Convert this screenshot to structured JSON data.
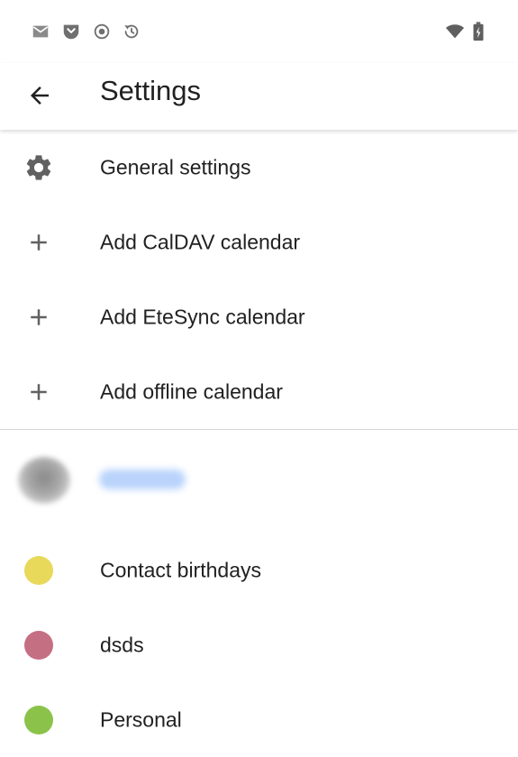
{
  "status_bar": {
    "icons": [
      "mail-icon",
      "pocket-icon",
      "record-icon",
      "sync-icon",
      "wifi-icon",
      "battery-icon"
    ]
  },
  "app_bar": {
    "title": "Settings",
    "back_icon": "arrow-back-icon"
  },
  "menu": [
    {
      "icon": "gear-icon",
      "label": "General settings"
    },
    {
      "icon": "plus-icon",
      "label": "Add CalDAV calendar"
    },
    {
      "icon": "plus-icon",
      "label": "Add EteSync calendar"
    },
    {
      "icon": "plus-icon",
      "label": "Add offline calendar"
    }
  ],
  "account": {
    "name": "account"
  },
  "calendars": [
    {
      "label": "Contact birthdays",
      "color": "#e8d95a"
    },
    {
      "label": "dsds",
      "color": "#c56f83"
    },
    {
      "label": "Personal",
      "color": "#8bc34a"
    }
  ],
  "colors": {
    "icon": "#616161",
    "text": "#212121",
    "divider": "#d6d6d6"
  }
}
